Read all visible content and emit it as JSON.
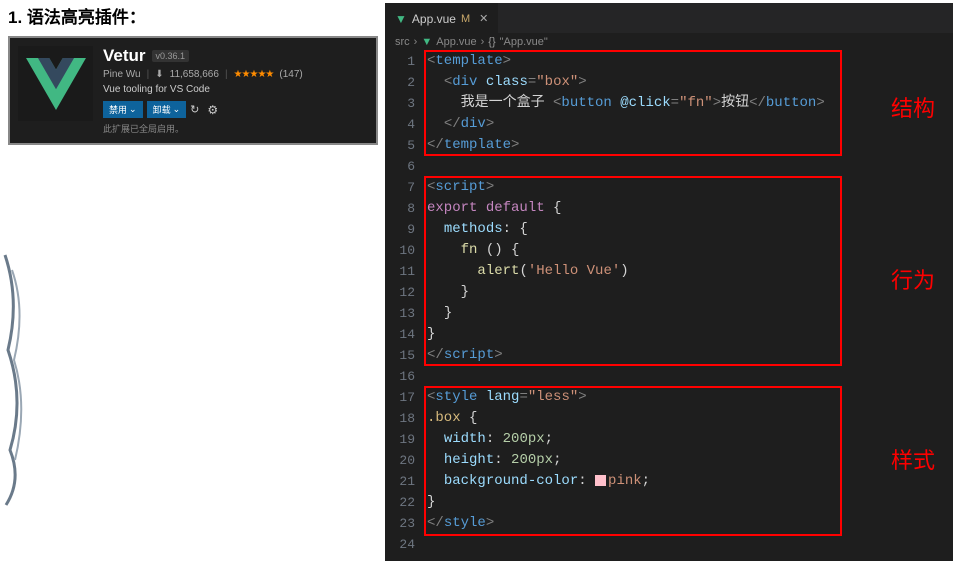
{
  "heading": "1. 语法高亮插件：",
  "extension": {
    "name": "Vetur",
    "version": "v0.36.1",
    "author": "Pine Wu",
    "installs": "11,658,666",
    "stars": "★★★★★",
    "rating_count": "(147)",
    "description": "Vue tooling for VS Code",
    "btn_disable": "禁用",
    "btn_uninstall": "卸载",
    "note": "此扩展已全局启用。"
  },
  "tab": {
    "filename": "App.vue",
    "modified": "M"
  },
  "breadcrumb": {
    "folder": "src",
    "file": "App.vue",
    "symbol": "\"App.vue\""
  },
  "code": {
    "lines": [
      "1",
      "2",
      "3",
      "4",
      "5",
      "6",
      "7",
      "8",
      "9",
      "10",
      "11",
      "12",
      "13",
      "14",
      "15",
      "16",
      "17",
      "18",
      "19",
      "20",
      "21",
      "22",
      "23",
      "24"
    ]
  },
  "annotations": {
    "structure": "结构",
    "behavior": "行为",
    "style": "样式"
  },
  "chart_data": {
    "type": "table",
    "title": "App.vue source code",
    "rows": [
      {
        "line": 1,
        "text": "<template>"
      },
      {
        "line": 2,
        "text": "  <div class=\"box\">"
      },
      {
        "line": 3,
        "text": "    我是一个盒子 <button @click=\"fn\">按钮</button>"
      },
      {
        "line": 4,
        "text": "  </div>"
      },
      {
        "line": 5,
        "text": "</template>"
      },
      {
        "line": 6,
        "text": ""
      },
      {
        "line": 7,
        "text": "<script>"
      },
      {
        "line": 8,
        "text": "export default {"
      },
      {
        "line": 9,
        "text": "  methods: {"
      },
      {
        "line": 10,
        "text": "    fn () {"
      },
      {
        "line": 11,
        "text": "      alert('Hello Vue')"
      },
      {
        "line": 12,
        "text": "    }"
      },
      {
        "line": 13,
        "text": "  }"
      },
      {
        "line": 14,
        "text": "}"
      },
      {
        "line": 15,
        "text": "</script>"
      },
      {
        "line": 16,
        "text": ""
      },
      {
        "line": 17,
        "text": "<style lang=\"less\">"
      },
      {
        "line": 18,
        "text": ".box {"
      },
      {
        "line": 19,
        "text": "  width: 200px;"
      },
      {
        "line": 20,
        "text": "  height: 200px;"
      },
      {
        "line": 21,
        "text": "  background-color: pink;"
      },
      {
        "line": 22,
        "text": "}"
      },
      {
        "line": 23,
        "text": "</style>"
      },
      {
        "line": 24,
        "text": ""
      }
    ]
  }
}
